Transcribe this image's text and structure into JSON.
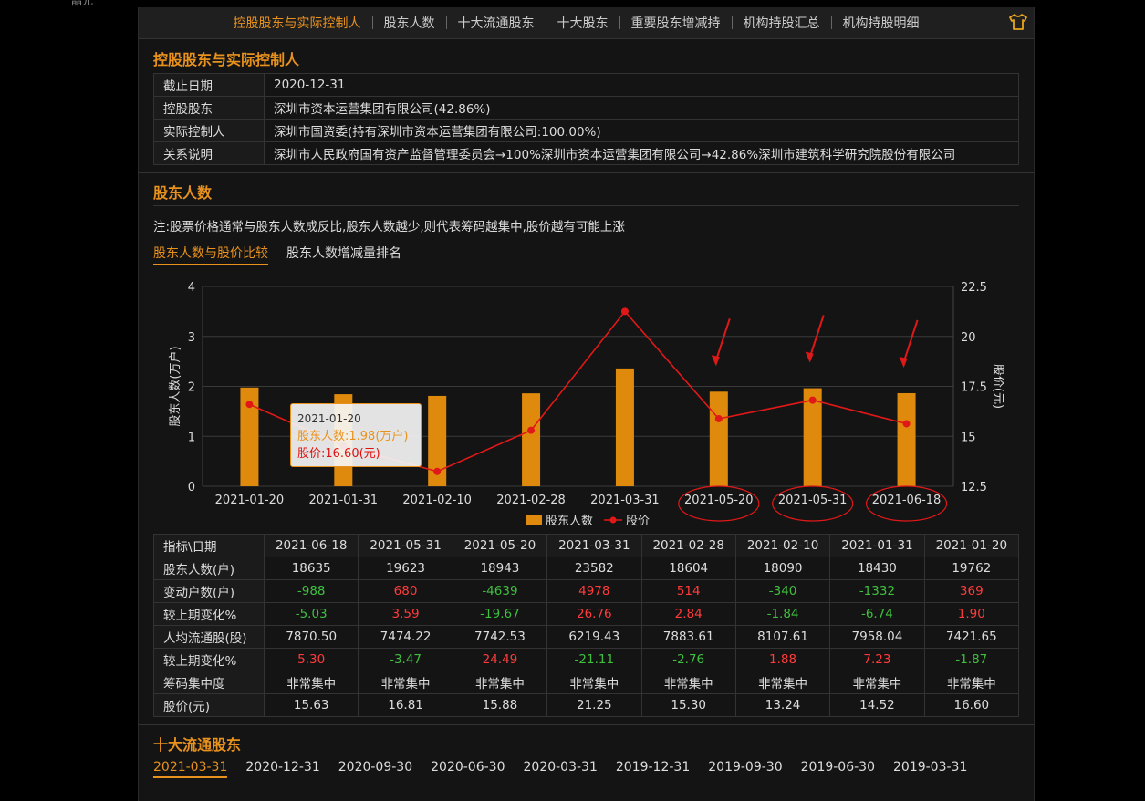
{
  "top_fragment": "晶元",
  "nav": {
    "items": [
      "控股股东与实际控制人",
      "股东人数",
      "十大流通股东",
      "十大股东",
      "重要股东增减持",
      "机构持股汇总",
      "机构持股明细"
    ],
    "active_index": 0,
    "right_icon": "shirt-icon"
  },
  "control": {
    "title": "控股股东与实际控制人",
    "rows": [
      {
        "label": "截止日期",
        "value": "2020-12-31"
      },
      {
        "label": "控股股东",
        "value": "深圳市资本运营集团有限公司(42.86%)"
      },
      {
        "label": "实际控制人",
        "value": "深圳市国资委(持有深圳市资本运营集团有限公司:100.00%)"
      },
      {
        "label": "关系说明",
        "value": "深圳市人民政府国有资产监督管理委员会→100%深圳市资本运营集团有限公司→42.86%深圳市建筑科学研究院股份有限公司"
      }
    ]
  },
  "holders": {
    "title": "股东人数",
    "note": "注:股票价格通常与股东人数成反比,股东人数越少,则代表筹码越集中,股价越有可能上涨",
    "subtabs": [
      "股东人数与股价比较",
      "股东人数增减量排名"
    ],
    "tooltip": {
      "date": "2021-01-20",
      "holders": "股东人数:1.98(万户)",
      "price": "股价:16.60(元)"
    },
    "table": {
      "header": [
        "指标\\日期",
        "2021-06-18",
        "2021-05-31",
        "2021-05-20",
        "2021-03-31",
        "2021-02-28",
        "2021-02-10",
        "2021-01-31",
        "2021-01-20"
      ],
      "rows": [
        {
          "label": "股东人数(户)",
          "cells": [
            "18635",
            "19623",
            "18943",
            "23582",
            "18604",
            "18090",
            "18430",
            "19762"
          ],
          "colored": false
        },
        {
          "label": "变动户数(户)",
          "cells": [
            "-988",
            "680",
            "-4639",
            "4978",
            "514",
            "-340",
            "-1332",
            "369"
          ],
          "colored": true
        },
        {
          "label": "较上期变化%",
          "cells": [
            "-5.03",
            "3.59",
            "-19.67",
            "26.76",
            "2.84",
            "-1.84",
            "-6.74",
            "1.90"
          ],
          "colored": true
        },
        {
          "label": "人均流通股(股)",
          "cells": [
            "7870.50",
            "7474.22",
            "7742.53",
            "6219.43",
            "7883.61",
            "8107.61",
            "7958.04",
            "7421.65"
          ],
          "colored": false
        },
        {
          "label": "较上期变化%",
          "cells": [
            "5.30",
            "-3.47",
            "24.49",
            "-21.11",
            "-2.76",
            "1.88",
            "7.23",
            "-1.87"
          ],
          "colored": true
        },
        {
          "label": "筹码集中度",
          "cells": [
            "非常集中",
            "非常集中",
            "非常集中",
            "非常集中",
            "非常集中",
            "非常集中",
            "非常集中",
            "非常集中"
          ],
          "colored": false
        },
        {
          "label": "股价(元)",
          "cells": [
            "15.63",
            "16.81",
            "15.88",
            "21.25",
            "15.30",
            "13.24",
            "14.52",
            "16.60"
          ],
          "colored": false
        }
      ]
    }
  },
  "chart_data": {
    "type": "bar",
    "categories": [
      "2021-01-20",
      "2021-01-31",
      "2021-02-10",
      "2021-02-28",
      "2021-03-31",
      "2021-05-20",
      "2021-05-31",
      "2021-06-18"
    ],
    "series": [
      {
        "name": "股东人数",
        "type": "bar",
        "axis": "left",
        "color": "#df8a0c",
        "values": [
          1.9762,
          1.843,
          1.809,
          1.8604,
          2.3582,
          1.8943,
          1.9623,
          1.8635
        ]
      },
      {
        "name": "股价",
        "type": "line",
        "axis": "right",
        "color": "#e01818",
        "values": [
          16.6,
          14.52,
          13.24,
          15.3,
          21.25,
          15.88,
          16.81,
          15.63
        ]
      }
    ],
    "ylabel": "股东人数(万户)",
    "y2label": "股价(元)",
    "ylim": [
      0,
      4
    ],
    "yticks": [
      "0",
      "1",
      "2",
      "3",
      "4"
    ],
    "y2lim": [
      12.5,
      22.5
    ],
    "y2ticks": [
      "12.5",
      "15",
      "17.5",
      "20",
      "22.5"
    ],
    "legend_position": "bottom-center",
    "grid": true,
    "annotations": [
      "red circles around 2021-05-20, 2021-05-31, 2021-06-18 labels",
      "red arrows pointing at last three bars"
    ]
  },
  "top10": {
    "title": "十大流通股东",
    "date_tabs": [
      "2021-03-31",
      "2020-12-31",
      "2020-09-30",
      "2020-06-30",
      "2020-03-31",
      "2019-12-31",
      "2019-09-30",
      "2019-06-30",
      "2019-03-31"
    ],
    "active_index": 0
  }
}
